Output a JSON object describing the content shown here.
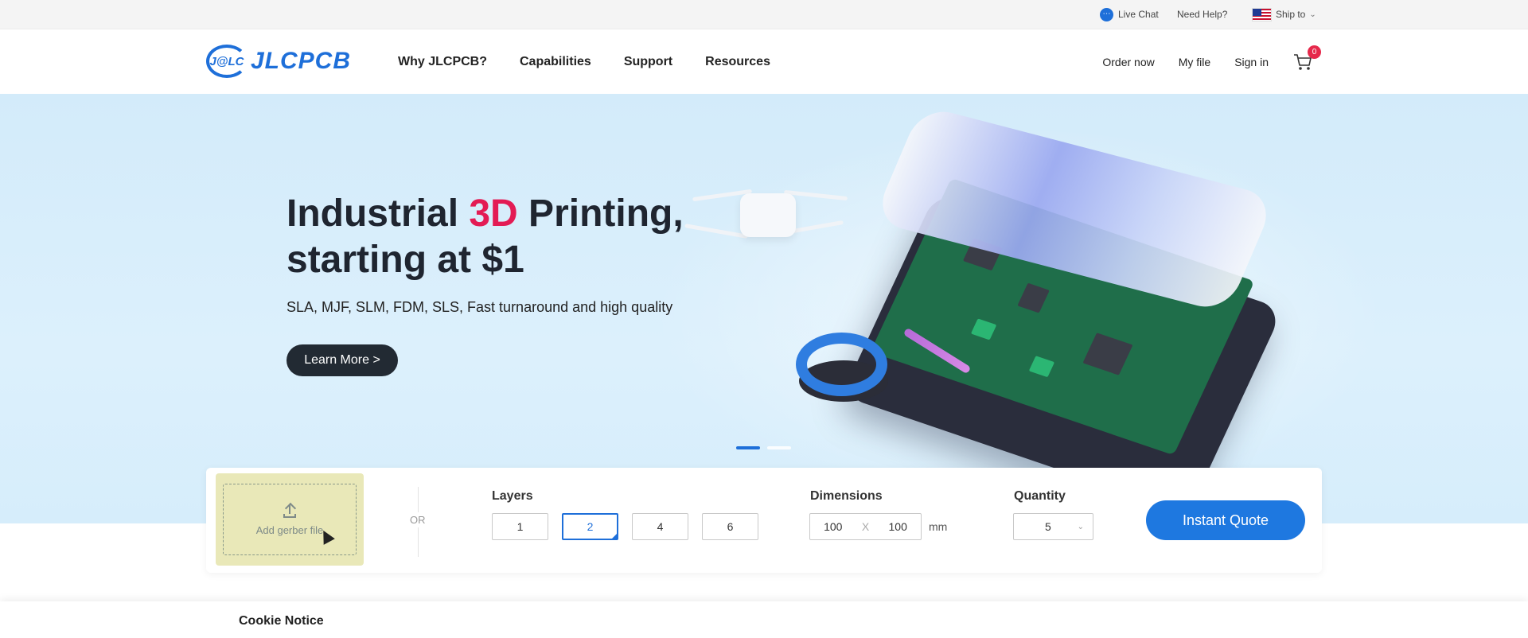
{
  "topbar": {
    "live_chat": "Live Chat",
    "need_help": "Need Help?",
    "ship_to": "Ship to"
  },
  "nav": {
    "logo_mark": "J@LC",
    "logo_text": "JLCPCB",
    "links": [
      "Why JLCPCB?",
      "Capabilities",
      "Support",
      "Resources"
    ],
    "order_now": "Order now",
    "my_file": "My file",
    "sign_in": "Sign in",
    "cart_count": "0"
  },
  "hero": {
    "title_part1": "Industrial ",
    "title_highlight": "3D",
    "title_part2": " Printing,",
    "title_line2": "starting at $1",
    "subtitle": "SLA, MJF, SLM, FDM, SLS, Fast turnaround and high quality",
    "cta": "Learn More >",
    "carousel": {
      "slides": 2,
      "active": 1
    }
  },
  "quote": {
    "upload_label": "Add gerber file",
    "or": "OR",
    "layers_label": "Layers",
    "layers": [
      "1",
      "2",
      "4",
      "6"
    ],
    "layers_selected": "2",
    "dimensions_label": "Dimensions",
    "dim_width": "100",
    "dim_x": "X",
    "dim_height": "100",
    "dim_unit": "mm",
    "quantity_label": "Quantity",
    "quantity": "5",
    "instant_quote": "Instant Quote"
  },
  "cookie": {
    "title": "Cookie Notice"
  },
  "colors": {
    "brand_blue": "#1e6fd9",
    "highlight_red": "#e31b54",
    "hero_bg": "#d3ebfa"
  },
  "icons": [
    "chat-icon",
    "us-flag-icon",
    "chevron-down-icon",
    "cart-icon",
    "upload-icon"
  ]
}
